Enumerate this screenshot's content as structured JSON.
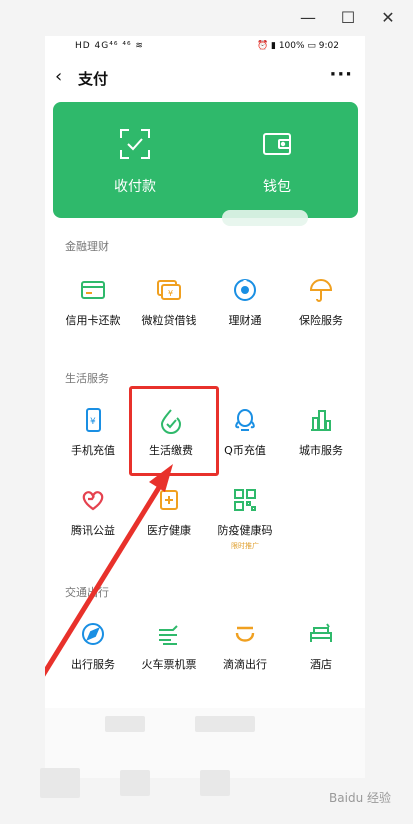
{
  "window": {
    "minimize": "—",
    "maximize": "☐",
    "close": "✕"
  },
  "status_bar": {
    "left": "HD 4G⁴⁶ ⁴⁶ ≋",
    "right": "⏰ ▮ 100% ▭ 9:02"
  },
  "nav": {
    "back": "‹",
    "title": "支付",
    "more": "···"
  },
  "top_card": {
    "items": [
      {
        "label": "收付款",
        "icon": "scan-qr-icon"
      },
      {
        "label": "钱包",
        "icon": "wallet-icon"
      }
    ],
    "color": "#2fb96b"
  },
  "sections": [
    {
      "title": "金融理财",
      "items": [
        {
          "label": "信用卡还款",
          "icon": "credit-card-icon"
        },
        {
          "label": "微粒贷借钱",
          "icon": "loan-icon"
        },
        {
          "label": "理财通",
          "icon": "wealth-icon"
        },
        {
          "label": "保险服务",
          "icon": "insurance-icon"
        }
      ]
    },
    {
      "title": "生活服务",
      "items": [
        {
          "label": "手机充值",
          "icon": "phone-topup-icon"
        },
        {
          "label": "生活缴费",
          "icon": "utility-payment-icon"
        },
        {
          "label": "Q币充值",
          "icon": "qq-coin-icon"
        },
        {
          "label": "城市服务",
          "icon": "city-service-icon"
        },
        {
          "label": "腾讯公益",
          "icon": "charity-icon"
        },
        {
          "label": "医疗健康",
          "icon": "medical-icon"
        },
        {
          "label": "防疫健康码",
          "icon": "health-code-icon",
          "sub": "限时推广"
        }
      ]
    },
    {
      "title": "交通出行",
      "items": [
        {
          "label": "出行服务",
          "icon": "travel-icon"
        },
        {
          "label": "火车票机票",
          "icon": "train-ticket-icon"
        },
        {
          "label": "滴滴出行",
          "icon": "didi-icon"
        },
        {
          "label": "酒店",
          "icon": "hotel-icon"
        }
      ]
    }
  ],
  "watermark": "Baidu 经验"
}
